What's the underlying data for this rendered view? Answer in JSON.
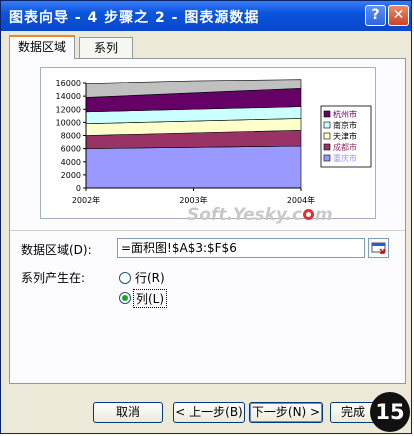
{
  "window": {
    "title": "图表向导 - 4 步骤之 2 - 图表源数据",
    "help_glyph": "?",
    "close_glyph": "✕"
  },
  "tabs": [
    {
      "label": "数据区域"
    },
    {
      "label": "系列"
    }
  ],
  "chart_data": {
    "type": "area",
    "stacked": true,
    "categories": [
      "2002年",
      "2003年",
      "2004年"
    ],
    "y_ticks": [
      "0",
      "2000",
      "4000",
      "6000",
      "8000",
      "10000",
      "12000",
      "14000",
      "16000"
    ],
    "ylim": [
      0,
      16000
    ],
    "x_tick_positions": [
      "start",
      "middle",
      "end"
    ],
    "series": [
      {
        "name": "重庆市",
        "values": [
          6000,
          6200,
          6400
        ],
        "color": "#9999ff",
        "text_color": "#9999ff"
      },
      {
        "name": "成都市",
        "values": [
          2000,
          2200,
          2400
        ],
        "color": "#993366",
        "text_color": "#993366"
      },
      {
        "name": "天津市",
        "values": [
          1800,
          1800,
          1800
        ],
        "color": "#ffffcc",
        "text_color": "#000000"
      },
      {
        "name": "南京市",
        "values": [
          1800,
          1800,
          1800
        ],
        "color": "#ccffff",
        "text_color": "#000000"
      },
      {
        "name": "杭州市",
        "values": [
          2200,
          2500,
          2800
        ],
        "color": "#660066",
        "text_color": "#660066"
      },
      {
        "name": "",
        "values": [
          2100,
          1800,
          1300
        ],
        "color": "#c0c0c0"
      }
    ],
    "legend_position": "right",
    "grid": false
  },
  "form": {
    "range_label": "数据区域(D):",
    "range_value": "=面积图!$A$3:$F$6",
    "series_in_label": "系列产生在:",
    "row_option": "行(R)",
    "col_option": "列(L)",
    "selected": "col"
  },
  "watermark": "Soft.Yesky.c",
  "watermark_tail": "m",
  "buttons": {
    "cancel": "取消",
    "back": "< 上一步(B)",
    "next": "下一步(N) >",
    "finish": "完成"
  },
  "step_badge": "15"
}
